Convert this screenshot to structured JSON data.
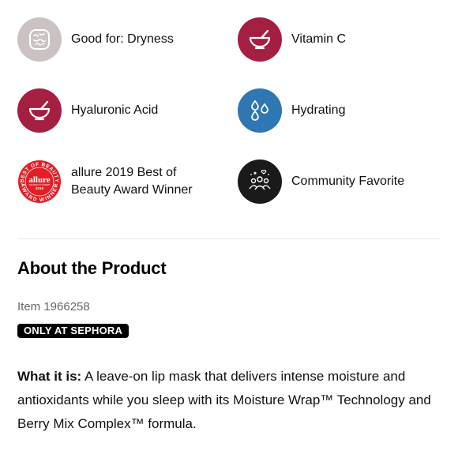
{
  "highlights": [
    {
      "label": "Good for: Dryness",
      "icon": "dry-skin-icon",
      "color": "#cbc3c3"
    },
    {
      "label": "Vitamin C",
      "icon": "mortar-bowl-icon",
      "color": "#a51f42"
    },
    {
      "label": "Hyaluronic Acid",
      "icon": "mortar-bowl-icon",
      "color": "#a51f42"
    },
    {
      "label": "Hydrating",
      "icon": "water-drops-icon",
      "color": "#2e77b3"
    },
    {
      "label": "allure 2019 Best of Beauty Award Winner",
      "icon": "allure-award-seal",
      "color": "#e21e26"
    },
    {
      "label": "Community Favorite",
      "icon": "community-icon",
      "color": "#1a1a1a"
    }
  ],
  "allure_seal": {
    "top": "BEST OF BEAUTY",
    "brand": "allure",
    "sub": "THE BEAUTY EXPERT",
    "year": "2019",
    "bottom": "AWARD WINNER"
  },
  "about": {
    "title": "About the Product",
    "item_number": "Item 1966258",
    "badge": "ONLY AT SEPHORA",
    "what_it_is_label": "What it is:",
    "what_it_is_text": " A leave-on lip mask that delivers intense moisture and antioxidants while you sleep with its Moisture Wrap™ Technology and Berry Mix Complex™ formula."
  }
}
